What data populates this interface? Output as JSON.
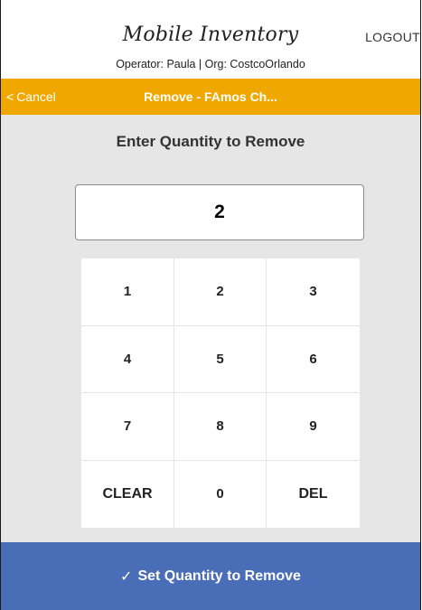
{
  "header": {
    "app_title": "Mobile Inventory",
    "operator_line": "Operator: Paula | Org: CostcoOrlando",
    "logout_label": "LOGOUT"
  },
  "navbar": {
    "cancel_label": "Cancel",
    "cancel_icon": "chevron-left-icon",
    "title": "Remove - FAmos Ch...",
    "color": "#f0a800"
  },
  "main": {
    "heading": "Enter Quantity to Remove",
    "quantity_value": "2"
  },
  "keypad": {
    "keys": [
      "1",
      "2",
      "3",
      "4",
      "5",
      "6",
      "7",
      "8",
      "9",
      "CLEAR",
      "0",
      "DEL"
    ]
  },
  "footer": {
    "check_icon": "✓",
    "submit_label": "Set Quantity to Remove",
    "color": "#4a6db7"
  }
}
